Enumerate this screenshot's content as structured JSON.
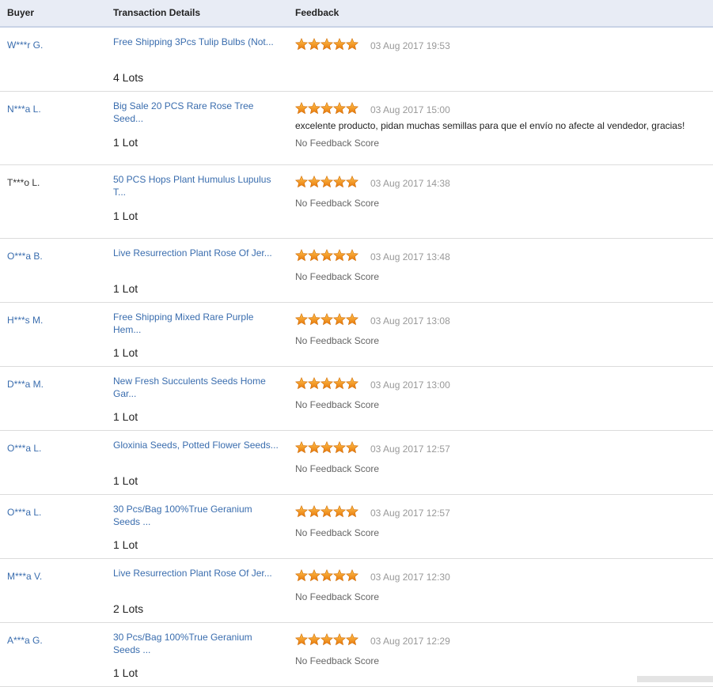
{
  "header": {
    "buyer": "Buyer",
    "details": "Transaction Details",
    "feedback": "Feedback"
  },
  "rows": [
    {
      "buyer": "W***r G.",
      "product": "Free Shipping 3Pcs Tulip Bulbs (Not...",
      "qty": "4 Lots",
      "rating": 5,
      "date": "03 Aug 2017 19:53",
      "comment": "",
      "score": ""
    },
    {
      "buyer": "N***a L.",
      "product": "Big Sale 20 PCS Rare Rose Tree Seed...",
      "qty": "1 Lot",
      "rating": 5,
      "date": "03 Aug 2017 15:00",
      "comment": "excelente producto, pidan muchas semillas para que el envío no afecte al vendedor, gracias!",
      "score": "No Feedback Score"
    },
    {
      "buyer": "T***o L.",
      "product": "50 PCS Hops Plant Humulus Lupulus T...",
      "qty": "1 Lot",
      "rating": 5,
      "date": "03 Aug 2017 14:38",
      "comment": "",
      "score": "No Feedback Score"
    },
    {
      "buyer": "O***a B.",
      "product": "Live Resurrection Plant Rose Of Jer...",
      "qty": "1 Lot",
      "rating": 5,
      "date": "03 Aug 2017 13:48",
      "comment": "",
      "score": "No Feedback Score"
    },
    {
      "buyer": "H***s M.",
      "product": "Free Shipping Mixed Rare Purple Hem...",
      "qty": "1 Lot",
      "rating": 5,
      "date": "03 Aug 2017 13:08",
      "comment": "",
      "score": "No Feedback Score"
    },
    {
      "buyer": "D***a M.",
      "product": "New Fresh Succulents Seeds Home Gar...",
      "qty": "1 Lot",
      "rating": 5,
      "date": "03 Aug 2017 13:00",
      "comment": "",
      "score": "No Feedback Score"
    },
    {
      "buyer": "O***a L.",
      "product": "Gloxinia Seeds, Potted Flower Seeds...",
      "qty": "1 Lot",
      "rating": 5,
      "date": "03 Aug 2017 12:57",
      "comment": "",
      "score": "No Feedback Score"
    },
    {
      "buyer": "O***a L.",
      "product": "30 Pcs/Bag 100%True Geranium Seeds ...",
      "qty": "1 Lot",
      "rating": 5,
      "date": "03 Aug 2017 12:57",
      "comment": "",
      "score": "No Feedback Score"
    },
    {
      "buyer": "M***a V.",
      "product": "Live Resurrection Plant Rose Of Jer...",
      "qty": "2 Lots",
      "rating": 5,
      "date": "03 Aug 2017 12:30",
      "comment": "",
      "score": "No Feedback Score"
    },
    {
      "buyer": "A***a G.",
      "product": "30 Pcs/Bag 100%True Geranium Seeds ...",
      "qty": "1 Lot",
      "rating": 5,
      "date": "03 Aug 2017 12:29",
      "comment": "",
      "score": "No Feedback Score"
    }
  ],
  "colors": {
    "link": "#3a6dae",
    "header_bg": "#e8ecf5",
    "star_fill": "#f29b1f"
  }
}
